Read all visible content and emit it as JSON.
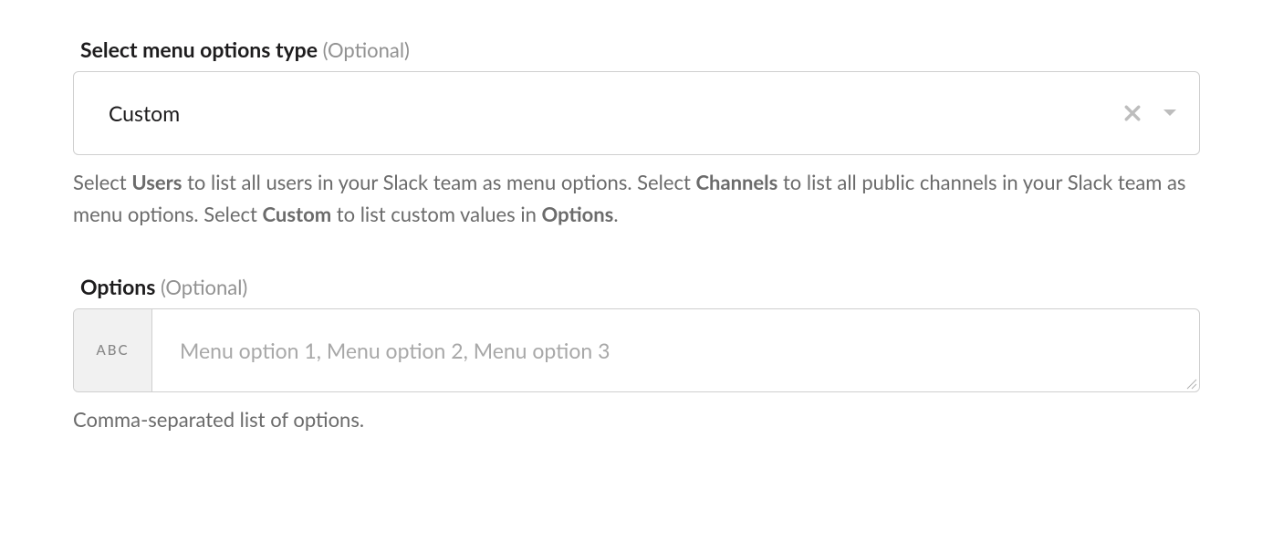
{
  "menuOptionsType": {
    "label": "Select menu options type",
    "optional_label": "(Optional)",
    "selected_value": "Custom",
    "help_prefix1": "Select ",
    "help_bold1": "Users",
    "help_mid1": " to list all users in your Slack team as menu options. Select ",
    "help_bold2": "Channels",
    "help_mid2": " to list all public channels in your Slack team as menu options. Select ",
    "help_bold3": "Custom",
    "help_mid3": " to list custom values in ",
    "help_bold4": "Options",
    "help_suffix": "."
  },
  "options": {
    "label": "Options",
    "optional_label": "(Optional)",
    "type_badge": "ABC",
    "placeholder": "Menu option 1, Menu option 2, Menu option 3",
    "help": "Comma-separated list of options."
  }
}
